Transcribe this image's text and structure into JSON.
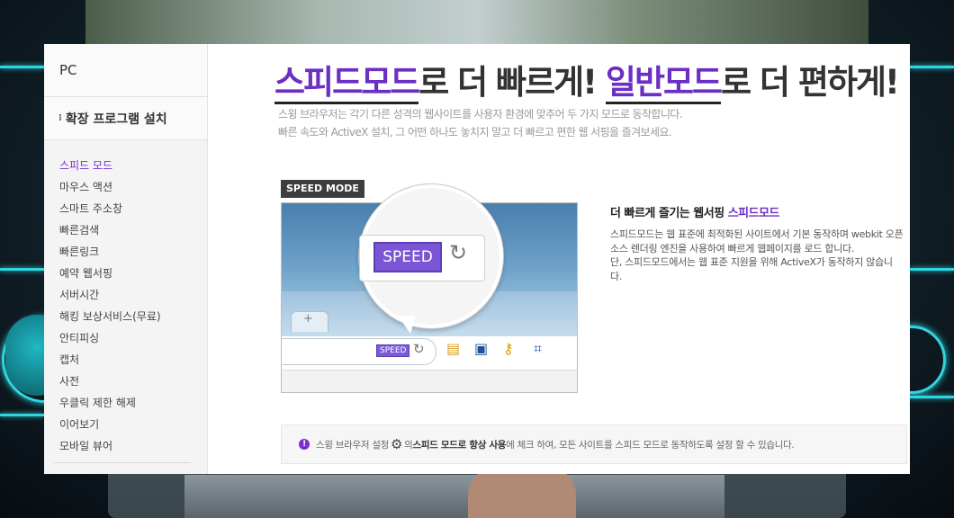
{
  "sidebar": {
    "pc_label": "PC",
    "extension_label": "확장 프로그램 설치",
    "items": [
      {
        "label": "스피드 모드",
        "active": true
      },
      {
        "label": "마우스 액션"
      },
      {
        "label": "스마트 주소창"
      },
      {
        "label": "빠른검색"
      },
      {
        "label": "빠른링크"
      },
      {
        "label": "예약 웹서핑"
      },
      {
        "label": "서버시간"
      },
      {
        "label": "해킹 보상서비스(무료)"
      },
      {
        "label": "안티피싱"
      },
      {
        "label": "캡처"
      },
      {
        "label": "사전"
      },
      {
        "label": "우클릭 제한 해제"
      },
      {
        "label": "이어보기"
      },
      {
        "label": "모바일 뷰어"
      }
    ]
  },
  "headline": {
    "part1": "스피드모드",
    "part2": "로 더 빠르게! ",
    "part3": "일반모드",
    "part4": "로 더 편하게!"
  },
  "subtitle": {
    "line1": "스윙 브라우저는 각기 다른 성격의 웹사이트를 사용자 환경에 맞추어 두 가지 모드로 동작합니다.",
    "line2": "빠른 속도와 ActiveX 설치, 그 어떤 하나도 놓치지 말고 더 빠르고 편한 웹 서핑을 즐겨보세요."
  },
  "mode_badge": "SPEED MODE",
  "illustration": {
    "speed_big": "SPEED",
    "speed_small": "SPEED",
    "reload_icon": "↻",
    "plus": "+"
  },
  "description": {
    "title_prefix": "더 빠르게 즐기는 웹서핑 ",
    "title_highlight": "스피드모드",
    "para1": "스피드모드는 웹 표준에 최적화된 사이트에서 기본 동작하며 webkit 오픈소스 렌더링 엔진을 사용하여 빠르게 웹페이지를 로드 합니다.",
    "para2": "단, 스피드모드에서는 웹 표준 지원을 위해 ActiveX가 동작하지 않습니다."
  },
  "notice": {
    "icon": "!",
    "prefix": "스윙 브라우저 설정",
    "gear_icon": "⚙",
    "mid": "의 ",
    "bold": "스피드 모드로 항상 사용",
    "suffix": "에 체크 하여, 모든 사이트를 스피드 모드로 동작하도록 설정 할 수 있습니다."
  },
  "colors": {
    "accent": "#6b2fc4",
    "cyan": "#2fd6e0"
  }
}
